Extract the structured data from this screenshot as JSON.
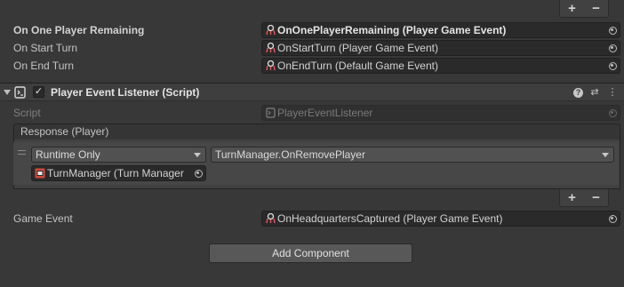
{
  "top_list": {
    "add_label": "+",
    "remove_label": "−"
  },
  "fields_top": [
    {
      "label": "On One Player Remaining",
      "value": "OnOnePlayerRemaining (Player Game Event)",
      "bold": true
    },
    {
      "label": "On Start Turn",
      "value": "OnStartTurn (Player Game Event)",
      "bold": false
    },
    {
      "label": "On End Turn",
      "value": "OnEndTurn (Default Game Event)",
      "bold": false
    }
  ],
  "component": {
    "title": "Player Event Listener (Script)",
    "enabled_mark": "✓",
    "help_icon": "?",
    "presets_icon": "⇄",
    "menu_icon": "⋮"
  },
  "script_field": {
    "label": "Script",
    "value": "PlayerEventListener"
  },
  "response": {
    "header": "Response (Player)",
    "runtime_option": "Runtime Only",
    "function": "TurnManager.OnRemovePlayer",
    "target_object": "TurnManager (Turn Manager",
    "add_label": "+",
    "remove_label": "−"
  },
  "game_event": {
    "label": "Game Event",
    "value": "OnHeadquartersCaptured (Player Game Event)"
  },
  "add_component_label": "Add Component",
  "colors": {
    "background": "#383838",
    "field_bg": "#2a2a2a",
    "accent_red": "#d04a3f"
  },
  "icons": {
    "game_event": "scriptable-object-icon",
    "script": "script-icon",
    "object_picker": "object-picker-icon",
    "turn_manager": "gameobject-icon"
  }
}
